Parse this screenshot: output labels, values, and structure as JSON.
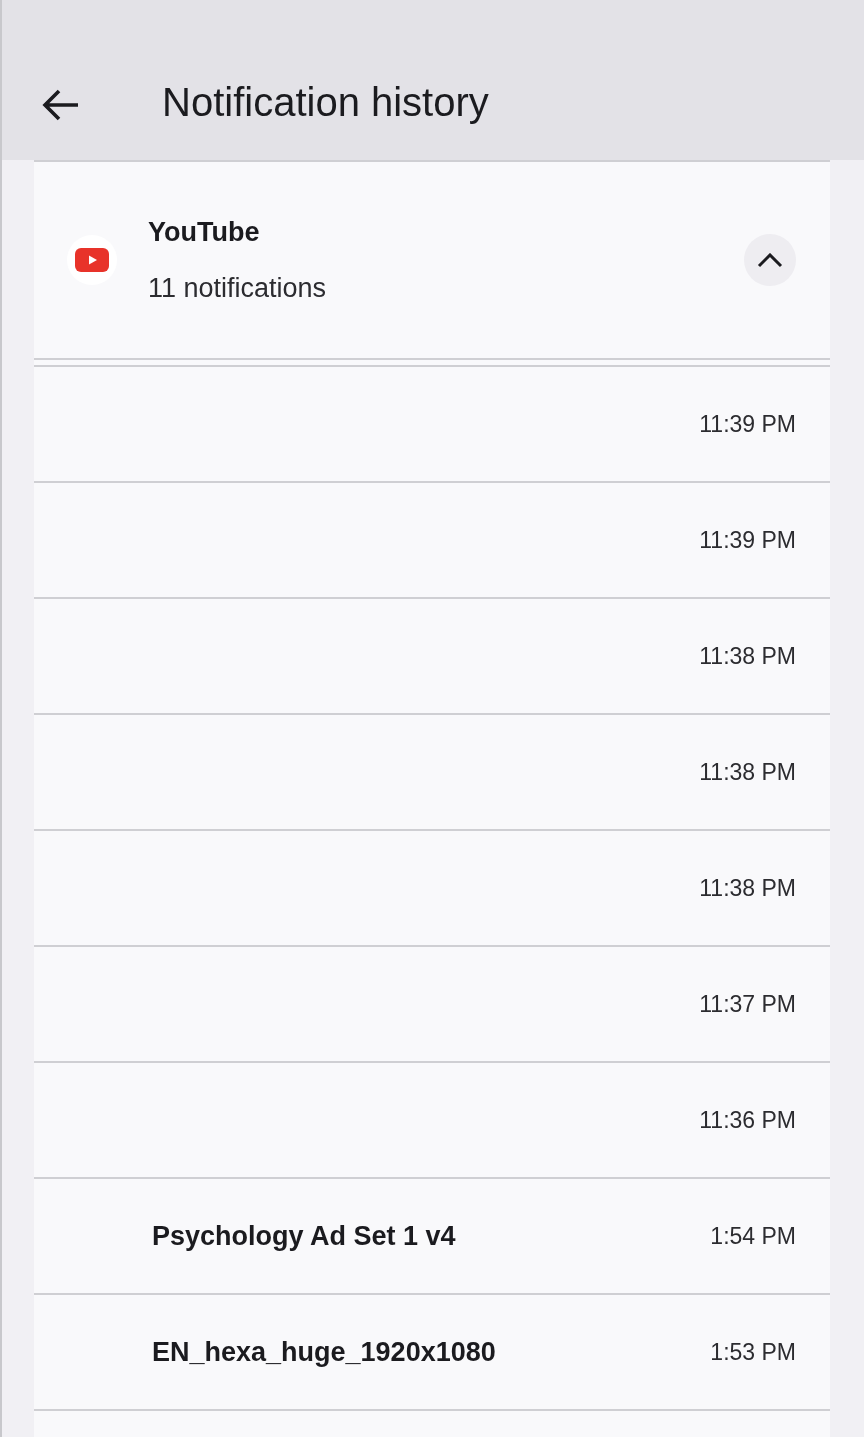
{
  "app_bar": {
    "title": "Notification history"
  },
  "app_group": {
    "name": "YouTube",
    "count": "11 notifications",
    "expanded": true
  },
  "notifications": [
    {
      "time": "11:39 PM"
    },
    {
      "time": "11:39 PM"
    },
    {
      "time": "11:38 PM"
    },
    {
      "time": "11:38 PM"
    },
    {
      "time": "11:38 PM"
    },
    {
      "time": "11:37 PM"
    },
    {
      "time": "11:36 PM"
    },
    {
      "title": "Psychology Ad Set 1 v4",
      "time": "1:54 PM"
    },
    {
      "title": "EN_hexa_huge_1920x1080",
      "time": "1:53 PM"
    }
  ]
}
